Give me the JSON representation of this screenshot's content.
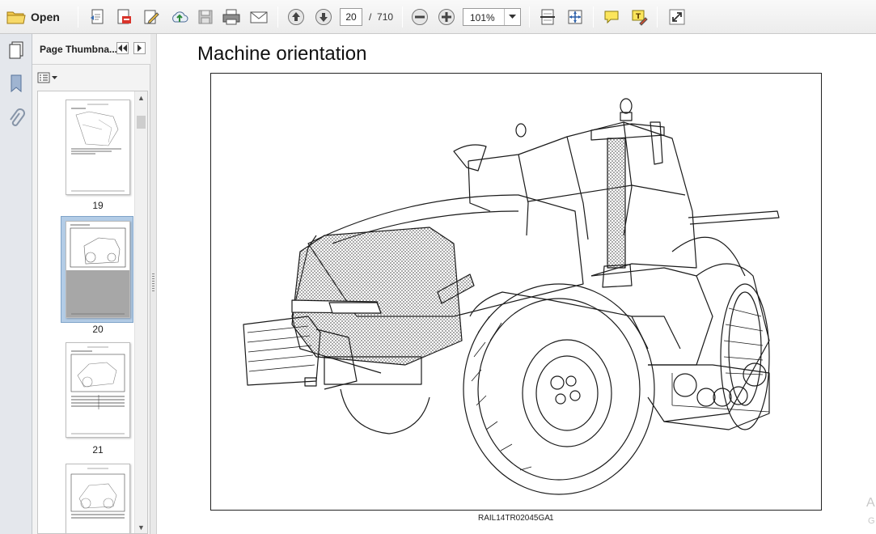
{
  "toolbar": {
    "open_label": "Open",
    "current_page": "20",
    "page_separator": "/",
    "total_pages": "710",
    "zoom_level": "101%"
  },
  "panel": {
    "title": "Page Thumbna...",
    "thumbnails": [
      {
        "label": "19"
      },
      {
        "label": "20"
      },
      {
        "label": "21"
      },
      {
        "label": ""
      }
    ]
  },
  "document": {
    "heading": "Machine orientation",
    "figure_code": "RAIL14TR02045GA",
    "figure_number": "1",
    "edge_text_line1": "A",
    "edge_text_line2": "G"
  },
  "colors": {
    "selection": "#b3cce6",
    "toolbar_bg": "#ececec",
    "rail_bg": "#e4e7ec"
  }
}
